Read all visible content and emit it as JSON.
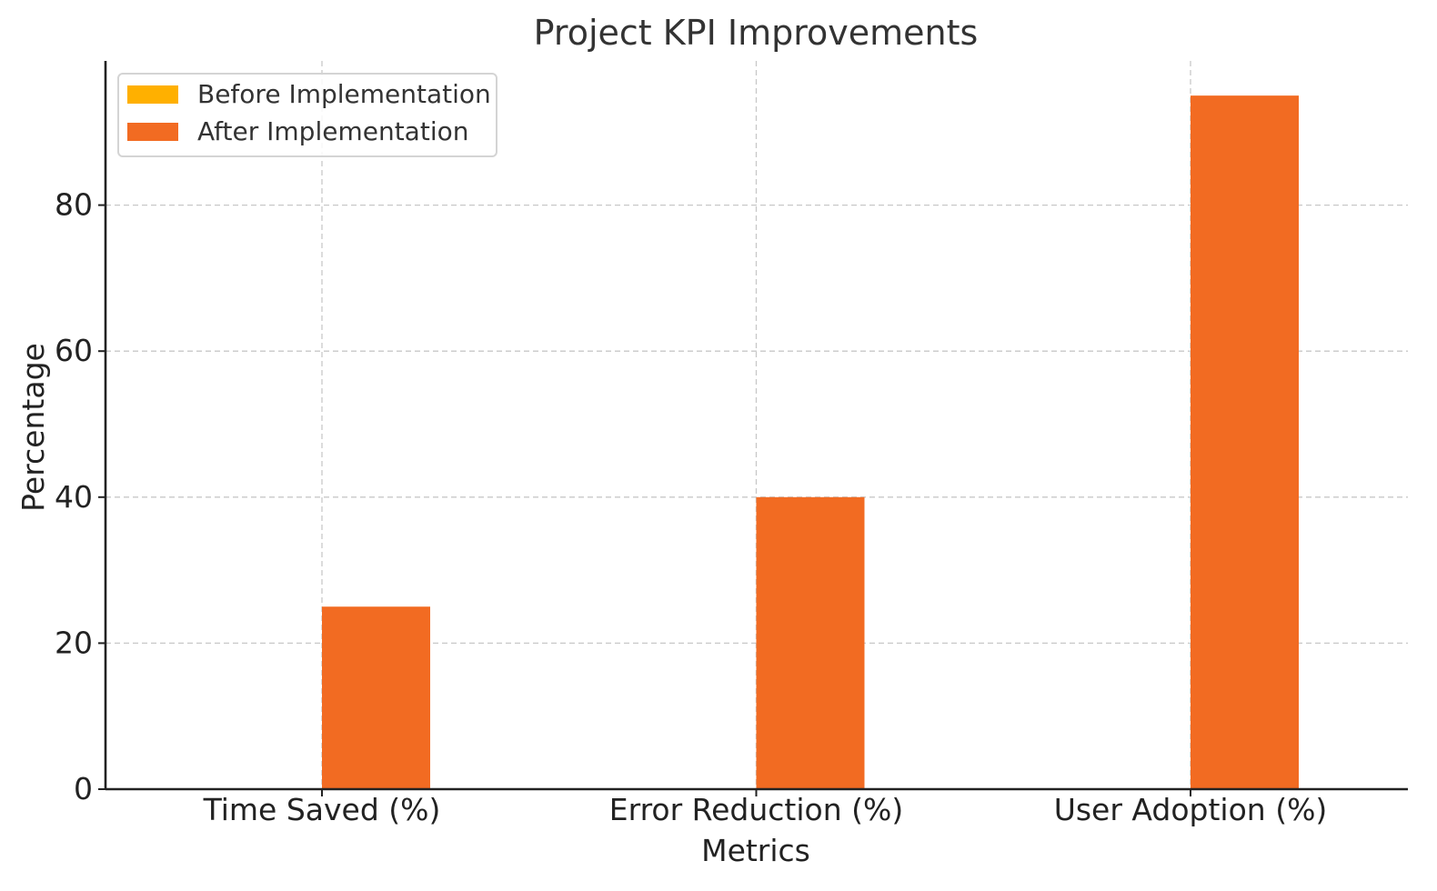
{
  "chart_data": {
    "type": "bar",
    "title": "Project KPI Improvements",
    "xlabel": "Metrics",
    "ylabel": "Percentage",
    "categories": [
      "Time Saved (%)",
      "Error Reduction (%)",
      "User Adoption (%)"
    ],
    "series": [
      {
        "name": "Before Implementation",
        "values": [
          0,
          0,
          0
        ],
        "color": "#FFB000"
      },
      {
        "name": "After Implementation",
        "values": [
          25,
          40,
          95
        ],
        "color": "#F26B22"
      }
    ],
    "ylim": [
      0,
      99.75
    ],
    "yticks": [
      0,
      20,
      40,
      60,
      80
    ],
    "grid": true,
    "legend_position": "top-left"
  }
}
